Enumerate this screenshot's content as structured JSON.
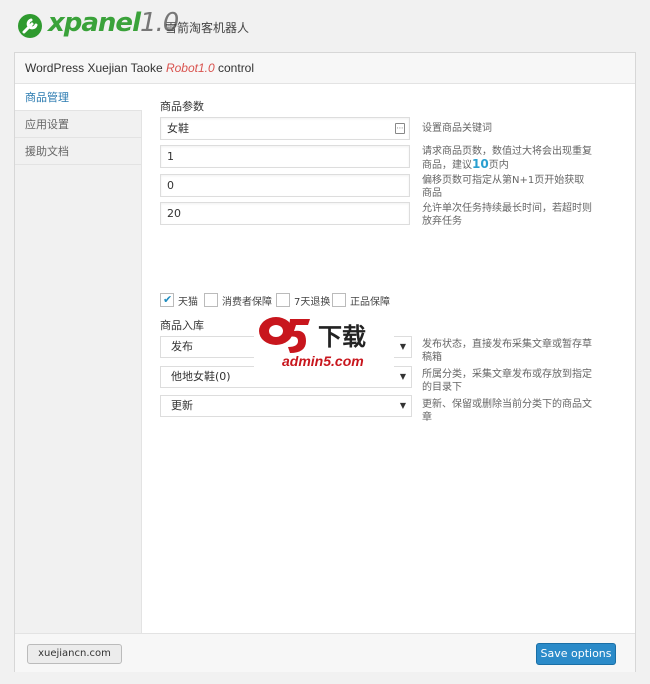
{
  "header": {
    "logo_main": "xpanel",
    "logo_version": "1.0",
    "subtitle": "雪箭淘客机器人"
  },
  "panel": {
    "title_prefix": "WordPress Xuejian Taoke ",
    "title_highlight": "Robot1.0",
    "title_suffix": " control"
  },
  "sidebar": {
    "items": [
      {
        "label": "商品管理"
      },
      {
        "label": "应用设置"
      },
      {
        "label": "援助文档"
      }
    ]
  },
  "params": {
    "section_title": "商品参数",
    "keyword": {
      "value": "女鞋",
      "desc": "设置商品关键词"
    },
    "pages": {
      "value": "1",
      "desc_a": "请求商品页数，数值过大将会出现重复商品，建议",
      "desc_num": "10",
      "desc_b": "页内"
    },
    "offset": {
      "value": "0",
      "desc": "偏移页数可指定从第N+1页开始获取商品"
    },
    "timeout": {
      "value": "20",
      "desc": "允许单次任务持续最长时间，若超时则放弃任务"
    },
    "checkboxes": [
      {
        "label": "天猫",
        "checked": true
      },
      {
        "label": "消费者保障",
        "checked": false
      },
      {
        "label": "7天退换",
        "checked": false
      },
      {
        "label": "正品保障",
        "checked": false
      }
    ]
  },
  "storage": {
    "section_title": "商品入库",
    "status": {
      "value": "发布",
      "desc": "发布状态，直接发布采集文章或暂存草稿箱"
    },
    "category": {
      "value": "他地女鞋(0)",
      "desc": "所属分类，采集文章发布或存放到指定的目录下"
    },
    "mode": {
      "value": "更新",
      "desc": "更新、保留或删除当前分类下的商品文章"
    }
  },
  "footer": {
    "site_button": "xuejiancn.com",
    "save_button": "Save options"
  },
  "watermark": {
    "dl": "下载",
    "url": "admin5.com"
  },
  "colors": {
    "accent": "#2b8bc9",
    "logo_green": "#3aa23a",
    "highlight_red": "#d9534f"
  }
}
